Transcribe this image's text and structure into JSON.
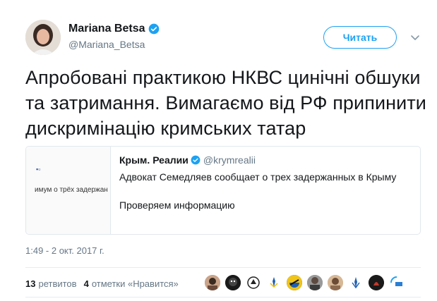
{
  "author": {
    "name": "Mariana Betsa",
    "handle": "@Mariana_Betsa"
  },
  "follow_label": "Читать",
  "tweet_text": "Апробовані практикою НКВС цинічні обшуки та затримання. Вимагаємо від РФ припинити дискримінацію кримських татар",
  "quoted": {
    "name": "Крым. Реалии",
    "handle": "@krymrealii",
    "line1": "Адвокат Семедляев сообщает о трех задержанных в Крыму",
    "line2": "Проверяем информацию",
    "thumb_text": "имум о трёх задержан"
  },
  "timestamp": "1:49 - 2 окт. 2017 г.",
  "stats": {
    "retweets_count": "13",
    "retweets_label": "ретвитов",
    "likes_count": "4",
    "likes_label": "отметки «Нравится»"
  },
  "colors": {
    "accent": "#1da1f2",
    "text": "#14171a",
    "secondary": "#657786",
    "border": "#e1e8ed"
  },
  "icons": {
    "verified": "verified-badge-icon",
    "caret": "chevron-down-icon"
  }
}
